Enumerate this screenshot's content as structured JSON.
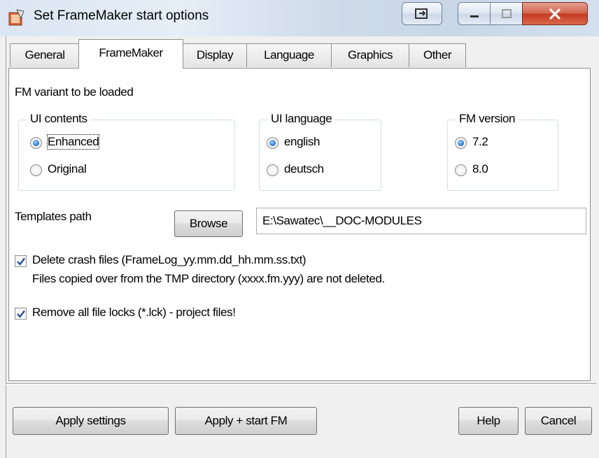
{
  "window": {
    "title": "Set FrameMaker start options"
  },
  "tabs": [
    {
      "label": "General"
    },
    {
      "label": "FrameMaker"
    },
    {
      "label": "Display"
    },
    {
      "label": "Language"
    },
    {
      "label": "Graphics"
    },
    {
      "label": "Other"
    }
  ],
  "active_tab": "FrameMaker",
  "section_label": "FM variant to be loaded",
  "ui_contents": {
    "title": "UI contents",
    "options": [
      {
        "label": "Enhanced",
        "selected": true
      },
      {
        "label": "Original",
        "selected": false
      }
    ]
  },
  "ui_language": {
    "title": "UI language",
    "options": [
      {
        "label": "english",
        "selected": true
      },
      {
        "label": "deutsch",
        "selected": false
      }
    ]
  },
  "fm_version": {
    "title": "FM version",
    "options": [
      {
        "label": "7.2",
        "selected": true
      },
      {
        "label": "8.0",
        "selected": false
      }
    ]
  },
  "templates": {
    "label": "Templates path",
    "browse_label": "Browse",
    "path_value": "E:\\Sawatec\\__DOC-MODULES"
  },
  "options": {
    "delete_crash": {
      "label": "Delete crash files (FrameLog_yy.mm.dd_hh.mm.ss.txt)",
      "note": "Files copied over from the TMP directory (xxxx.fm.yyy) are not deleted.",
      "checked": true
    },
    "remove_locks": {
      "label": "Remove all file locks (*.lck) - project files!",
      "checked": true
    }
  },
  "buttons": {
    "apply_settings": "Apply settings",
    "apply_start": "Apply + start FM",
    "help": "Help",
    "cancel": "Cancel"
  }
}
